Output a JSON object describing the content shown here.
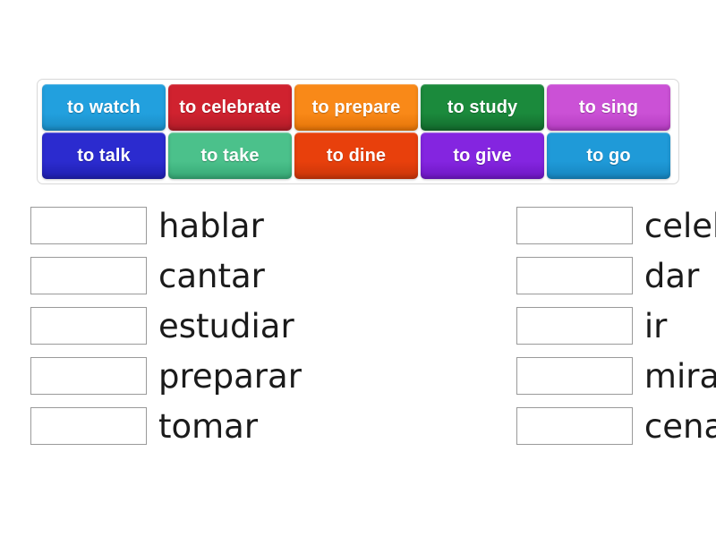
{
  "activity": {
    "type": "match-up",
    "language_pair": "English to Spanish"
  },
  "tile_bank": {
    "rows": [
      [
        {
          "label": "to watch",
          "color": "#22A0DE",
          "color_dark": "#1A8CC4"
        },
        {
          "label": "to celebrate",
          "color": "#D0222F",
          "color_dark": "#B01C28"
        },
        {
          "label": "to prepare",
          "color": "#F98918",
          "color_dark": "#E57408"
        },
        {
          "label": "to study",
          "color": "#1B8A3C",
          "color_dark": "#136A2D"
        },
        {
          "label": "to sing",
          "color": "#CB51D6",
          "color_dark": "#B43CC0"
        }
      ],
      [
        {
          "label": "to talk",
          "color": "#2B2BCF",
          "color_dark": "#1F1FAE"
        },
        {
          "label": "to take",
          "color": "#4BC18B",
          "color_dark": "#36A775"
        },
        {
          "label": "to dine",
          "color": "#E8400C",
          "color_dark": "#C93509"
        },
        {
          "label": "to give",
          "color": "#8425E0",
          "color_dark": "#6D16C2"
        },
        {
          "label": "to go",
          "color": "#1F9AD8",
          "color_dark": "#1684BE"
        }
      ]
    ]
  },
  "answers": {
    "left_column": [
      {
        "word": "hablar",
        "dropped": ""
      },
      {
        "word": "cantar",
        "dropped": ""
      },
      {
        "word": "estudiar",
        "dropped": ""
      },
      {
        "word": "preparar",
        "dropped": ""
      },
      {
        "word": "tomar",
        "dropped": ""
      }
    ],
    "right_column": [
      {
        "word": "celebrar",
        "dropped": ""
      },
      {
        "word": "dar",
        "dropped": ""
      },
      {
        "word": "ir",
        "dropped": ""
      },
      {
        "word": "mirar",
        "dropped": ""
      },
      {
        "word": "cenar",
        "dropped": ""
      }
    ]
  }
}
